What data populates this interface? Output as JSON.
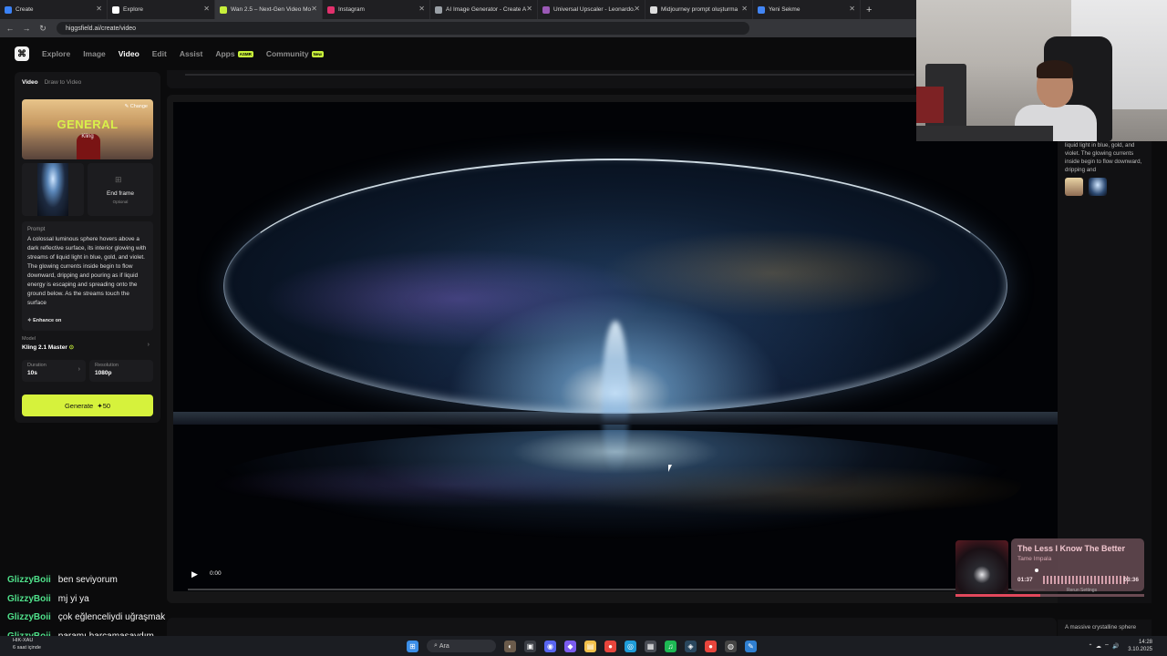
{
  "browser": {
    "tabs": [
      {
        "label": "Create",
        "color": "#3b82f6"
      },
      {
        "label": "Explore",
        "color": "#ffffff"
      },
      {
        "label": "Wan 2.5 – Next-Gen Video Mo",
        "color": "#c8f03b"
      },
      {
        "label": "Instagram",
        "color": "#e1306c"
      },
      {
        "label": "AI Image Generator - Create A",
        "color": "#9aa0a6"
      },
      {
        "label": "Universal Upscaler - Leonardo.",
        "color": "#9b59b6"
      },
      {
        "label": "Midjourney prompt oluşturma",
        "color": "#dddddd"
      },
      {
        "label": "Yeni Sekme",
        "color": "#4285f4"
      }
    ],
    "url": "higgsfield.ai/create/video"
  },
  "nav": {
    "items": [
      "Explore",
      "Image",
      "Video",
      "Edit",
      "Assist",
      "Apps",
      "Community"
    ],
    "apps_badge": "ASMR",
    "community_badge": "New"
  },
  "panel": {
    "tabs": [
      "Video",
      "Draw to Video"
    ],
    "preset_title": "GENERAL",
    "preset_subtitle": "Kling",
    "change_label": "Change",
    "end_frame_label": "End frame",
    "end_frame_hint": "Optional",
    "prompt_label": "Prompt",
    "prompt_text": "A colossal luminous sphere hovers above a dark reflective surface, its interior glowing with streams of liquid light in blue, gold, and violet. The glowing currents inside begin to flow downward, dripping and pouring as if liquid energy is escaping and spreading onto the ground below. As the streams touch the surface",
    "enhance_label": "Enhance on",
    "model_label": "Model",
    "model_value": "Kling 2.1 Master",
    "duration_label": "Duration",
    "duration_value": "10s",
    "resolution_label": "Resolution",
    "resolution_value": "1080p",
    "generate_label": "Generate",
    "generate_cost": "50"
  },
  "video": {
    "time": "0:00"
  },
  "right": {
    "text": "liquid light in blue, gold, and violet. The glowing currents inside begin to flow downward, dripping and",
    "bottom_text": "A massive crystalline sphere"
  },
  "music": {
    "title": "The Less I Know The Better",
    "artist": "Tame Impala",
    "elapsed": "01:37",
    "total": "03:36",
    "progress": 0.45
  },
  "under_music": "Rerun   Settings",
  "chat": [
    {
      "user": "GlizzyBoii",
      "msg": "ben seviyorum"
    },
    {
      "user": "GlizzyBoii",
      "msg": "mj yi ya"
    },
    {
      "user": "GlizzyBoii",
      "msg": "çok eğlenceliydi uğraşmak"
    },
    {
      "user": "GlizzyBoii",
      "msg": "paramı harcamasaydım"
    }
  ],
  "taskbar": {
    "weather_line1": "HIK-XAU",
    "weather_line2": "6 saat içinde",
    "search_placeholder": "Ara",
    "time": "14:28",
    "date": "3.10.2025"
  }
}
